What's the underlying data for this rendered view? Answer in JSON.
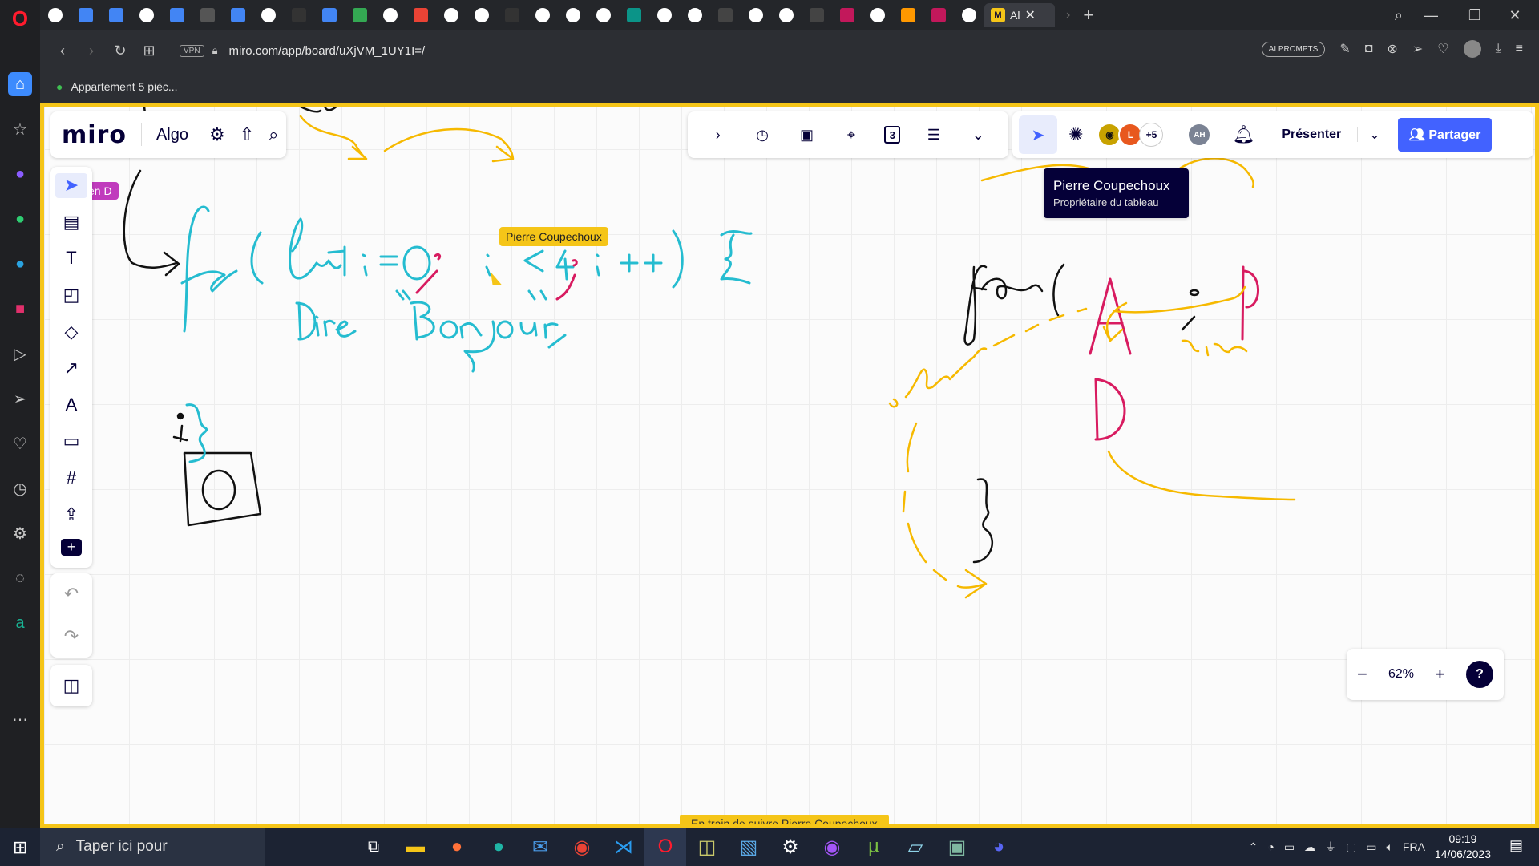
{
  "browser": {
    "tabs": [
      {
        "icon": "chevron-left-icon",
        "color": "#ffffff"
      },
      {
        "icon": "docs-icon",
        "color": "#4285f4"
      },
      {
        "icon": "docs-icon",
        "color": "#4285f4"
      },
      {
        "icon": "google-icon",
        "color": "#ffffff"
      },
      {
        "icon": "docs-icon",
        "color": "#4285f4"
      },
      {
        "icon": "site-icon",
        "color": "#555555"
      },
      {
        "icon": "docs-icon",
        "color": "#4285f4"
      },
      {
        "icon": "globe-icon",
        "color": "#ffffff"
      },
      {
        "icon": "m-site-icon",
        "color": "#333333"
      },
      {
        "icon": "docs-icon",
        "color": "#4285f4"
      },
      {
        "icon": "drive-icon",
        "color": "#34a853"
      },
      {
        "icon": "globe-icon",
        "color": "#ffffff"
      },
      {
        "icon": "app-icon",
        "color": "#ea4335"
      },
      {
        "icon": "record-icon",
        "color": "#ffffff"
      },
      {
        "icon": "globe-icon",
        "color": "#ffffff"
      },
      {
        "icon": "m-site-icon",
        "color": "#333333"
      },
      {
        "icon": "google-icon",
        "color": "#ffffff"
      },
      {
        "icon": "globe-icon",
        "color": "#ffffff"
      },
      {
        "icon": "site-icon",
        "color": "#ffffff"
      },
      {
        "icon": "site-icon",
        "color": "#0b9488"
      },
      {
        "icon": "globe-icon",
        "color": "#ffffff"
      },
      {
        "icon": "google-icon",
        "color": "#ffffff"
      },
      {
        "icon": "apps-icon",
        "color": "#444444"
      },
      {
        "icon": "google-icon",
        "color": "#ffffff"
      },
      {
        "icon": "wikipedia-icon",
        "color": "#ffffff"
      },
      {
        "icon": "clock-icon",
        "color": "#444444"
      },
      {
        "icon": "a-site-icon",
        "color": "#c2185b"
      },
      {
        "icon": "globe-icon",
        "color": "#ffffff"
      },
      {
        "icon": "chart-icon",
        "color": "#ff9800"
      },
      {
        "icon": "a-site-icon",
        "color": "#c2185b"
      },
      {
        "icon": "google-icon",
        "color": "#ffffff"
      }
    ],
    "active_tab": {
      "label": "Al",
      "icon": "miro-icon"
    },
    "url": "miro.com/app/board/uXjVM_1UY1I=/",
    "vpn_label": "VPN",
    "ai_prompts_label": "AI PROMPTS",
    "bookmark": "Appartement 5 pièc..."
  },
  "miro": {
    "logo": "miro",
    "board_name": "Algo",
    "tooltip": {
      "name": "Pierre Coupechoux",
      "role": "Propriétaire du tableau"
    },
    "avatar_l": "L",
    "avatar_more": "+5",
    "avatar_ah": "AH",
    "present_label": "Présenter",
    "share_label": "Partager",
    "counter_icon_label": "3",
    "zoom": "62%",
    "help": "?",
    "following": "En train de suivre Pierre Coupechoux",
    "cursor_label": "Pierre Coupechoux",
    "user_label": "ven D",
    "colors": {
      "accent": "#4262ff",
      "follow": "#f5c518",
      "ink_cyan": "#25bcd0",
      "ink_magenta": "#d81b60",
      "ink_yellow": "#f6b900"
    }
  },
  "taskbar": {
    "search_placeholder": "Taper ici pour",
    "language": "FRA",
    "time": "09:19",
    "date": "14/06/2023"
  }
}
